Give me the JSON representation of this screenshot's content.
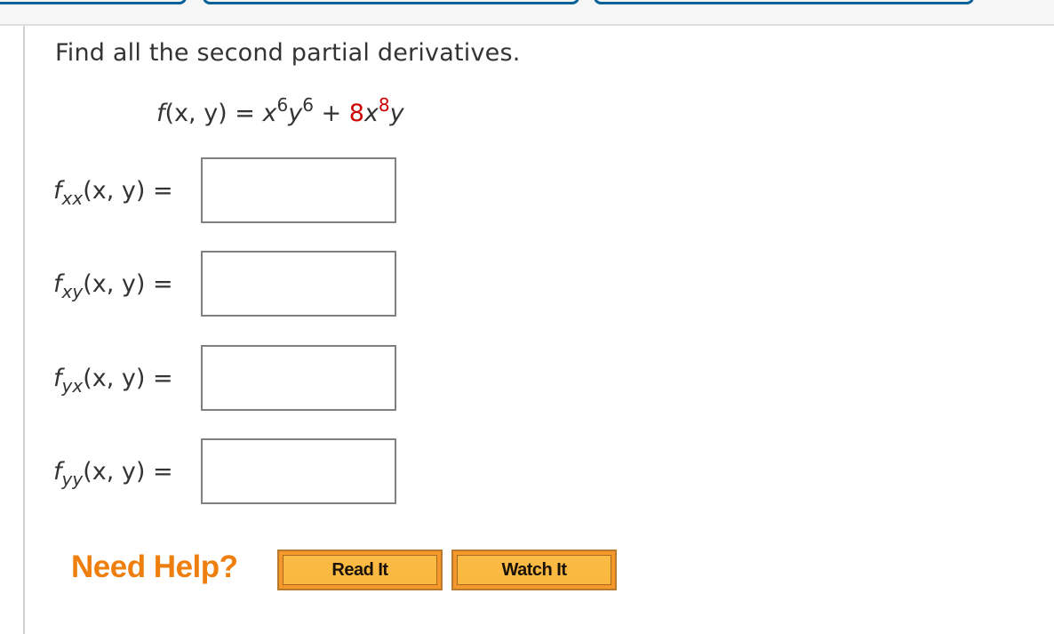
{
  "question": {
    "prompt": "Find all the second partial derivatives.",
    "function": {
      "lhs_f": "f",
      "lhs_args": "(x, y)",
      "equals": " = ",
      "term1_base_x": "x",
      "term1_exp_x": "6",
      "term1_base_y": "y",
      "term1_exp_y": "6",
      "plus": " + ",
      "term2_coef": "8",
      "term2_base_x": "x",
      "term2_exp_x": "8",
      "term2_base_y": "y"
    },
    "accent_color": "#cc0000"
  },
  "answers": [
    {
      "f": "f",
      "subscript": "xx",
      "args": "(x, y)",
      "equals": " =",
      "value": ""
    },
    {
      "f": "f",
      "subscript": "xy",
      "args": "(x, y)",
      "equals": " =",
      "value": ""
    },
    {
      "f": "f",
      "subscript": "yx",
      "args": "(x, y)",
      "equals": " =",
      "value": ""
    },
    {
      "f": "f",
      "subscript": "yy",
      "args": "(x, y)",
      "equals": " =",
      "value": ""
    }
  ],
  "help": {
    "label": "Need Help?",
    "buttons": [
      {
        "label": "Read It"
      },
      {
        "label": "Watch It"
      }
    ],
    "label_color": "#ee7f0e",
    "button_color": "#fbbb45"
  },
  "top_tabs_color": "#086199"
}
